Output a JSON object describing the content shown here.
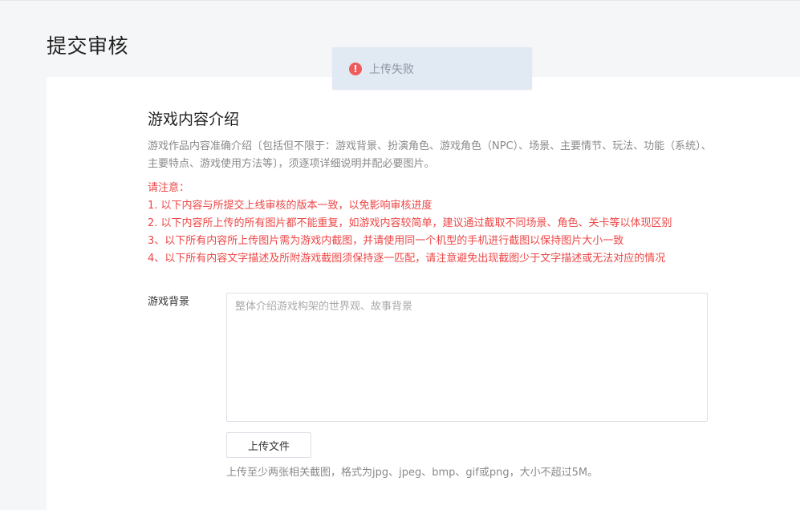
{
  "page": {
    "title": "提交审核"
  },
  "toast": {
    "icon": "error-icon",
    "icon_glyph": "!",
    "icon_color": "#f05a5a",
    "message": "上传失败"
  },
  "section": {
    "title": "游戏内容介绍",
    "description": "游戏作品内容准确介绍〔包括但不限于：游戏背景、扮演角色、游戏角色（NPC）、场景、主要情节、玩法、功能（系统）、主要特点、游戏使用方法等〕，须逐项详细说明并配必要图片。",
    "notice_title": "请注意：",
    "notice_color": "#ee4646",
    "notices": [
      "1. 以下内容与所提交上线审核的版本一致，以免影响审核进度",
      "2. 以下内容所上传的所有图片都不能重复，如游戏内容较简单，建议通过截取不同场景、角色、关卡等以体现区别",
      "3、以下所有内容所上传图片需为游戏内截图，并请使用同一个机型的手机进行截图以保持图片大小一致",
      "4、以下所有内容文字描述及所附游戏截图须保持逐一匹配，请注意避免出现截图少于文字描述或无法对应的情况"
    ]
  },
  "form": {
    "background_label": "游戏背景",
    "background_value": "",
    "background_placeholder": "整体介绍游戏构架的世界观、故事背景",
    "upload_button_label": "上传文件",
    "upload_hint": "上传至少两张相关截图，格式为jpg、jpeg、bmp、gif或png，大小不超过5M。"
  }
}
